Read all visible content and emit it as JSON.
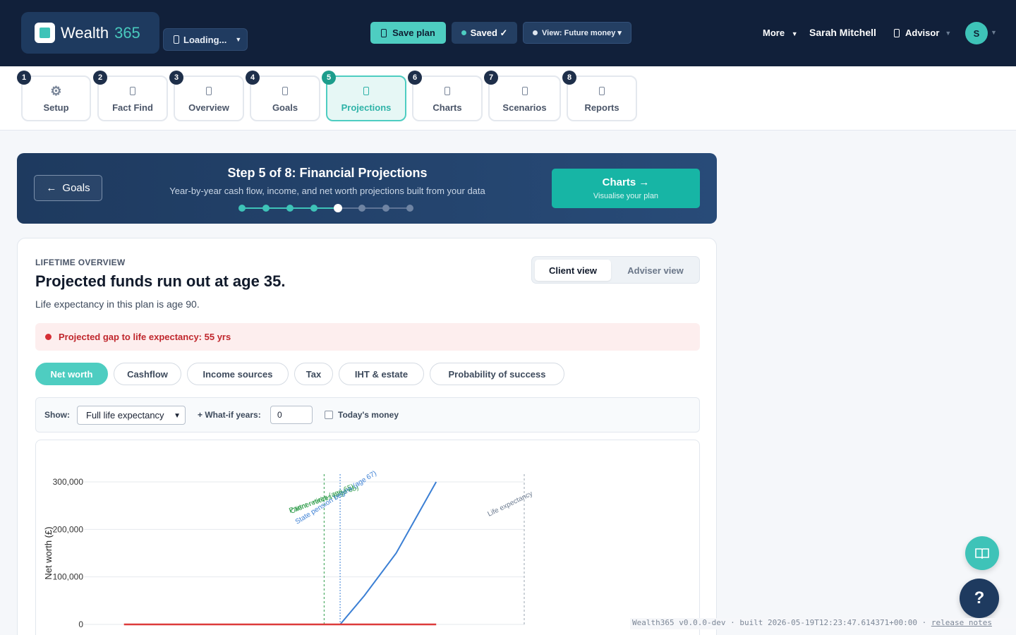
{
  "header": {
    "brand_name": "Wealth",
    "brand_number": "365",
    "loading_label": "Loading...",
    "save_label": "Save plan",
    "saved_label": "Saved ✓",
    "view_label": "View: Future money ▾",
    "more_label": "More",
    "user_name": "Sarah Mitchell",
    "role_label": "Advisor",
    "avatar_initial": "S"
  },
  "steps": [
    {
      "num": "1",
      "label": "Setup",
      "icon": "gear-icon"
    },
    {
      "num": "2",
      "label": "Fact Find",
      "icon": "clipboard-icon"
    },
    {
      "num": "3",
      "label": "Overview",
      "icon": "overview-icon"
    },
    {
      "num": "4",
      "label": "Goals",
      "icon": "target-icon"
    },
    {
      "num": "5",
      "label": "Projections",
      "icon": "projection-icon",
      "active": true
    },
    {
      "num": "6",
      "label": "Charts",
      "icon": "chart-icon"
    },
    {
      "num": "7",
      "label": "Scenarios",
      "icon": "scenario-icon"
    },
    {
      "num": "8",
      "label": "Reports",
      "icon": "report-icon"
    }
  ],
  "banner": {
    "back_label": "Goals",
    "title": "Step 5 of 8: Financial Projections",
    "subtitle": "Year-by-year cash flow, income, and net worth projections built from your data",
    "current_step": 5,
    "total_steps": 8,
    "next_label": "Charts →",
    "next_sub": "Visualise your plan"
  },
  "overview": {
    "eyebrow": "LIFETIME OVERVIEW",
    "headline": "Projected funds run out at age 35.",
    "subline": "Life expectancy in this plan is age 90.",
    "view_client": "Client view",
    "view_adviser": "Adviser view",
    "alert": "Projected gap to life expectancy: 55 yrs"
  },
  "tabs": [
    "Net worth",
    "Cashflow",
    "Income sources",
    "Tax",
    "IHT & estate",
    "Probability of success"
  ],
  "controls": {
    "show_label": "Show:",
    "show_value": "Full life expectancy",
    "whatif_label": "+ What-if years:",
    "whatif_value": "0",
    "todays_money_label": "Today's money"
  },
  "chart_data": {
    "type": "line",
    "ylabel": "Net worth (£)",
    "yticks": [
      "300,000",
      "200,000",
      "100,000",
      "0"
    ],
    "ylim": [
      0,
      300000
    ],
    "grid": true,
    "annotations": [
      "Client retires (age 65)",
      "Partner retires (age 65)",
      "State pension begins (age 67)",
      "Life expectancy"
    ],
    "series": [
      {
        "color": "#3b7fd4",
        "points": [
          [
            65,
            0
          ],
          [
            67,
            0
          ],
          [
            70,
            60000
          ],
          [
            74,
            150000
          ],
          [
            77,
            240000
          ],
          [
            79,
            300000
          ]
        ]
      },
      {
        "color": "#dd3b3b",
        "points": [
          [
            40,
            0
          ],
          [
            79,
            0
          ]
        ]
      }
    ]
  },
  "footer": {
    "version": "Wealth365 v0.0.0-dev · built 2026-05-19T12:23:47.614371+00:00 · ",
    "release_notes": "release notes"
  }
}
